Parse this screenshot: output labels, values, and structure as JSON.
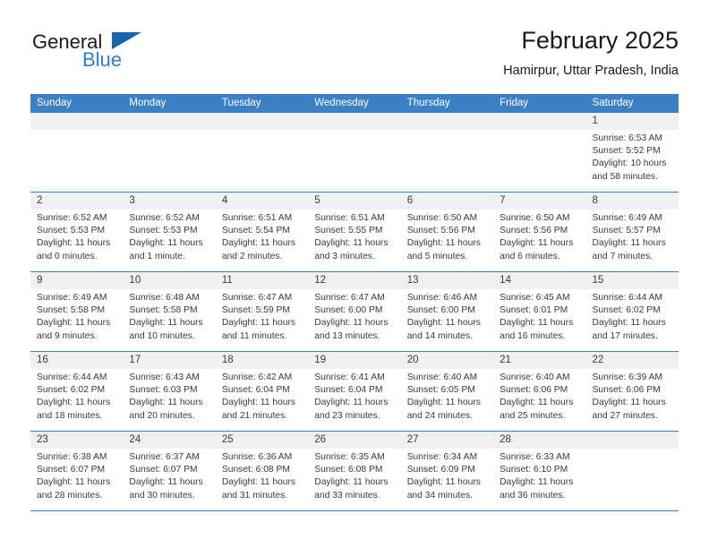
{
  "logo": {
    "word1": "General",
    "word2": "Blue",
    "triangle_color": "#1565b0",
    "word2_color": "#2a7fc9"
  },
  "header": {
    "month_title": "February 2025",
    "location": "Hamirpur, Uttar Pradesh, India"
  },
  "theme": {
    "header_blue": "#3b7fc4",
    "day_band_gray": "#f0f0f0",
    "text_color": "#3a3a3a"
  },
  "weekdays": [
    "Sunday",
    "Monday",
    "Tuesday",
    "Wednesday",
    "Thursday",
    "Friday",
    "Saturday"
  ],
  "labels": {
    "sunrise": "Sunrise:",
    "sunset": "Sunset:",
    "daylight": "Daylight:"
  },
  "weeks": [
    [
      {
        "day": ""
      },
      {
        "day": ""
      },
      {
        "day": ""
      },
      {
        "day": ""
      },
      {
        "day": ""
      },
      {
        "day": ""
      },
      {
        "day": "1",
        "sunrise": "Sunrise: 6:53 AM",
        "sunset": "Sunset: 5:52 PM",
        "daylight_line1": "Daylight: 10 hours",
        "daylight_line2": "and 58 minutes."
      }
    ],
    [
      {
        "day": "2",
        "sunrise": "Sunrise: 6:52 AM",
        "sunset": "Sunset: 5:53 PM",
        "daylight_line1": "Daylight: 11 hours",
        "daylight_line2": "and 0 minutes."
      },
      {
        "day": "3",
        "sunrise": "Sunrise: 6:52 AM",
        "sunset": "Sunset: 5:53 PM",
        "daylight_line1": "Daylight: 11 hours",
        "daylight_line2": "and 1 minute."
      },
      {
        "day": "4",
        "sunrise": "Sunrise: 6:51 AM",
        "sunset": "Sunset: 5:54 PM",
        "daylight_line1": "Daylight: 11 hours",
        "daylight_line2": "and 2 minutes."
      },
      {
        "day": "5",
        "sunrise": "Sunrise: 6:51 AM",
        "sunset": "Sunset: 5:55 PM",
        "daylight_line1": "Daylight: 11 hours",
        "daylight_line2": "and 3 minutes."
      },
      {
        "day": "6",
        "sunrise": "Sunrise: 6:50 AM",
        "sunset": "Sunset: 5:56 PM",
        "daylight_line1": "Daylight: 11 hours",
        "daylight_line2": "and 5 minutes."
      },
      {
        "day": "7",
        "sunrise": "Sunrise: 6:50 AM",
        "sunset": "Sunset: 5:56 PM",
        "daylight_line1": "Daylight: 11 hours",
        "daylight_line2": "and 6 minutes."
      },
      {
        "day": "8",
        "sunrise": "Sunrise: 6:49 AM",
        "sunset": "Sunset: 5:57 PM",
        "daylight_line1": "Daylight: 11 hours",
        "daylight_line2": "and 7 minutes."
      }
    ],
    [
      {
        "day": "9",
        "sunrise": "Sunrise: 6:49 AM",
        "sunset": "Sunset: 5:58 PM",
        "daylight_line1": "Daylight: 11 hours",
        "daylight_line2": "and 9 minutes."
      },
      {
        "day": "10",
        "sunrise": "Sunrise: 6:48 AM",
        "sunset": "Sunset: 5:58 PM",
        "daylight_line1": "Daylight: 11 hours",
        "daylight_line2": "and 10 minutes."
      },
      {
        "day": "11",
        "sunrise": "Sunrise: 6:47 AM",
        "sunset": "Sunset: 5:59 PM",
        "daylight_line1": "Daylight: 11 hours",
        "daylight_line2": "and 11 minutes."
      },
      {
        "day": "12",
        "sunrise": "Sunrise: 6:47 AM",
        "sunset": "Sunset: 6:00 PM",
        "daylight_line1": "Daylight: 11 hours",
        "daylight_line2": "and 13 minutes."
      },
      {
        "day": "13",
        "sunrise": "Sunrise: 6:46 AM",
        "sunset": "Sunset: 6:00 PM",
        "daylight_line1": "Daylight: 11 hours",
        "daylight_line2": "and 14 minutes."
      },
      {
        "day": "14",
        "sunrise": "Sunrise: 6:45 AM",
        "sunset": "Sunset: 6:01 PM",
        "daylight_line1": "Daylight: 11 hours",
        "daylight_line2": "and 16 minutes."
      },
      {
        "day": "15",
        "sunrise": "Sunrise: 6:44 AM",
        "sunset": "Sunset: 6:02 PM",
        "daylight_line1": "Daylight: 11 hours",
        "daylight_line2": "and 17 minutes."
      }
    ],
    [
      {
        "day": "16",
        "sunrise": "Sunrise: 6:44 AM",
        "sunset": "Sunset: 6:02 PM",
        "daylight_line1": "Daylight: 11 hours",
        "daylight_line2": "and 18 minutes."
      },
      {
        "day": "17",
        "sunrise": "Sunrise: 6:43 AM",
        "sunset": "Sunset: 6:03 PM",
        "daylight_line1": "Daylight: 11 hours",
        "daylight_line2": "and 20 minutes."
      },
      {
        "day": "18",
        "sunrise": "Sunrise: 6:42 AM",
        "sunset": "Sunset: 6:04 PM",
        "daylight_line1": "Daylight: 11 hours",
        "daylight_line2": "and 21 minutes."
      },
      {
        "day": "19",
        "sunrise": "Sunrise: 6:41 AM",
        "sunset": "Sunset: 6:04 PM",
        "daylight_line1": "Daylight: 11 hours",
        "daylight_line2": "and 23 minutes."
      },
      {
        "day": "20",
        "sunrise": "Sunrise: 6:40 AM",
        "sunset": "Sunset: 6:05 PM",
        "daylight_line1": "Daylight: 11 hours",
        "daylight_line2": "and 24 minutes."
      },
      {
        "day": "21",
        "sunrise": "Sunrise: 6:40 AM",
        "sunset": "Sunset: 6:06 PM",
        "daylight_line1": "Daylight: 11 hours",
        "daylight_line2": "and 25 minutes."
      },
      {
        "day": "22",
        "sunrise": "Sunrise: 6:39 AM",
        "sunset": "Sunset: 6:06 PM",
        "daylight_line1": "Daylight: 11 hours",
        "daylight_line2": "and 27 minutes."
      }
    ],
    [
      {
        "day": "23",
        "sunrise": "Sunrise: 6:38 AM",
        "sunset": "Sunset: 6:07 PM",
        "daylight_line1": "Daylight: 11 hours",
        "daylight_line2": "and 28 minutes."
      },
      {
        "day": "24",
        "sunrise": "Sunrise: 6:37 AM",
        "sunset": "Sunset: 6:07 PM",
        "daylight_line1": "Daylight: 11 hours",
        "daylight_line2": "and 30 minutes."
      },
      {
        "day": "25",
        "sunrise": "Sunrise: 6:36 AM",
        "sunset": "Sunset: 6:08 PM",
        "daylight_line1": "Daylight: 11 hours",
        "daylight_line2": "and 31 minutes."
      },
      {
        "day": "26",
        "sunrise": "Sunrise: 6:35 AM",
        "sunset": "Sunset: 6:08 PM",
        "daylight_line1": "Daylight: 11 hours",
        "daylight_line2": "and 33 minutes."
      },
      {
        "day": "27",
        "sunrise": "Sunrise: 6:34 AM",
        "sunset": "Sunset: 6:09 PM",
        "daylight_line1": "Daylight: 11 hours",
        "daylight_line2": "and 34 minutes."
      },
      {
        "day": "28",
        "sunrise": "Sunrise: 6:33 AM",
        "sunset": "Sunset: 6:10 PM",
        "daylight_line1": "Daylight: 11 hours",
        "daylight_line2": "and 36 minutes."
      },
      {
        "day": ""
      }
    ]
  ]
}
